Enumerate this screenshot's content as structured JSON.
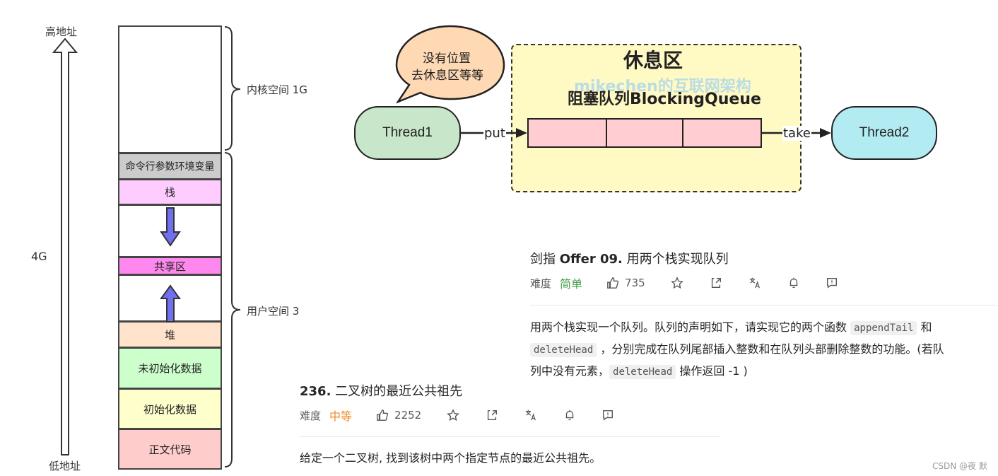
{
  "memory": {
    "high_addr": "高地址",
    "low_addr": "低地址",
    "total": "4G",
    "kernel_space": "内核空间 1G",
    "user_space": "用户空间 3",
    "segments": {
      "env": "命令行参数环境变量",
      "stack": "栈",
      "shared": "共享区",
      "heap": "堆",
      "bss": "未初始化数据",
      "data": "初始化数据",
      "text": "正文代码"
    }
  },
  "queue": {
    "bubble_line1": "没有位置",
    "bubble_line2": "去休息区等等",
    "rest_area": "休息区",
    "watermark": "mikechen的互联网架构",
    "queue_title": "阻塞队列BlockingQueue",
    "thread1": "Thread1",
    "thread2": "Thread2",
    "put": "put",
    "take": "take"
  },
  "problem1": {
    "prefix": "剑指 ",
    "bold": "Offer 09.",
    "title": " 用两个栈实现队列",
    "difficulty_label": "难度",
    "difficulty": "简单",
    "likes": "735",
    "desc_part1": "用两个栈实现一个队列。队列的声明如下，请实现它的两个函数 ",
    "code1": "appendTail",
    "desc_part2": " 和",
    "code2": "deleteHead",
    "desc_part3": " ，分别完成在队列尾部插入整数和在队列头部删除整数的功能。(若队",
    "desc_part4": "列中没有元素，",
    "code3": "deleteHead",
    "desc_part5": " 操作返回 -1 )"
  },
  "problem2": {
    "number": "236.",
    "title": " 二叉树的最近公共祖先",
    "difficulty_label": "难度",
    "difficulty": "中等",
    "likes": "2252",
    "desc": "给定一个二叉树, 找到该树中两个指定节点的最近公共祖先。"
  },
  "footer": {
    "credit": "CSDN @夜 默"
  },
  "colors": {
    "easy": "#43a047",
    "medium": "#ef8a23",
    "kernel": "#ffffff",
    "env": "#cccccc",
    "stack": "#ffccff",
    "shared": "#ff88ee",
    "heap": "#ffe3cc",
    "bss": "#ccffcc",
    "data": "#ffffcc",
    "text": "#ffcccc"
  }
}
